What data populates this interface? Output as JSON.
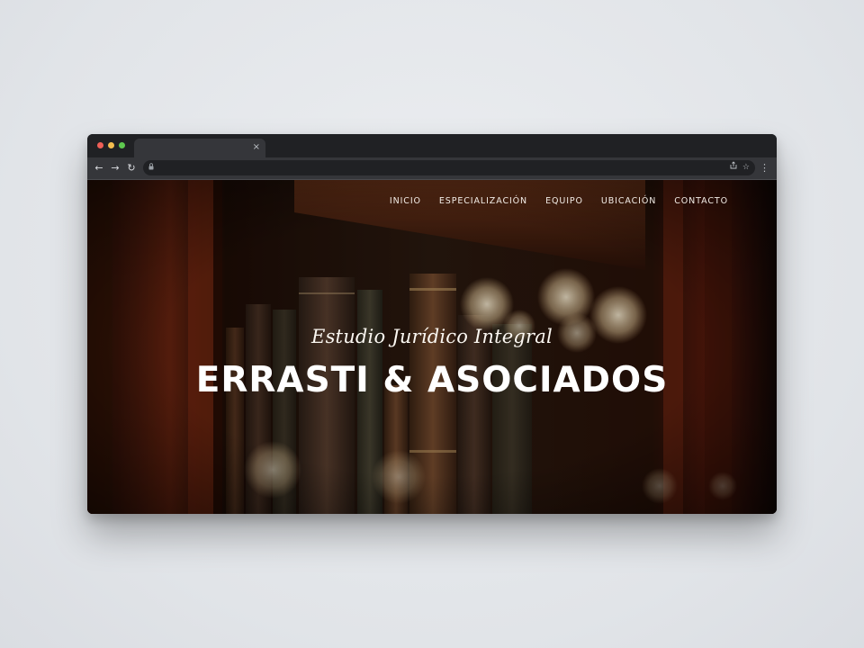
{
  "browser": {
    "tab_close": "×",
    "icons": {
      "back": "arrow-left-icon",
      "forward": "arrow-right-icon",
      "reload": "reload-icon",
      "lock": "lock-icon",
      "share": "share-icon",
      "star": "star-icon",
      "menu": "more-vertical-icon"
    }
  },
  "site": {
    "nav": [
      {
        "label": "INICIO"
      },
      {
        "label": "ESPECIALIZACIÓN"
      },
      {
        "label": "EQUIPO"
      },
      {
        "label": "UBICACIÓN"
      },
      {
        "label": "CONTACTO"
      }
    ],
    "hero": {
      "subtitle": "Estudio Jurídico Integral",
      "title": "ERRASTI & ASOCIADOS"
    }
  },
  "colors": {
    "page_bg": "#e3e6ea",
    "chrome_dark": "#202124",
    "chrome_toolbar": "#35363a",
    "hero_dark": "#1a0e08",
    "hero_wood": "#5a1f10",
    "text_light": "#ffffff"
  }
}
